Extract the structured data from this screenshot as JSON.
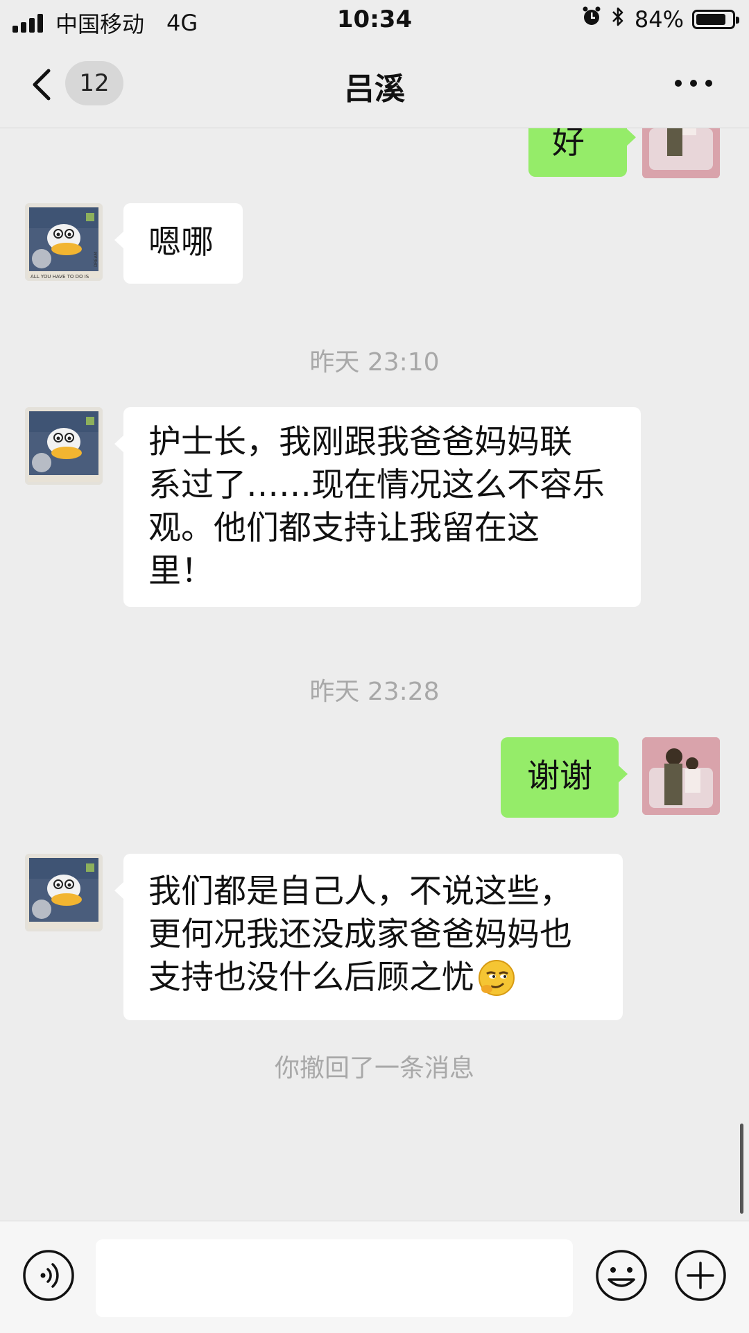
{
  "status_bar": {
    "carrier": "中国移动",
    "network": "4G",
    "time": "10:34",
    "battery_text": "84%",
    "battery_level": 0.84
  },
  "nav": {
    "unread_count": "12",
    "title": "吕溪"
  },
  "messages": {
    "m0_text": "好",
    "m1_text": "嗯哪",
    "ts1": "昨天 23:10",
    "m2_lines": [
      "护士长，我刚跟我爸爸妈妈联",
      "系过了……现在情况这么不容乐",
      "观。他们都支持让我留在这",
      "里！"
    ],
    "ts2": "昨天 23:28",
    "m3_text": "谢谢",
    "m4_lines": [
      "我们都是自己人，不说这些，",
      "更何况我还没成家爸爸妈妈也",
      "支持也没什么后顾之忧"
    ],
    "m4_emoji": "smirking-face-emoji",
    "recall_notice": "你撤回了一条消息",
    "duck_avatar_caption": "ALL YOU HAVE TO DO IS",
    "duck_avatar_side_caption": "DREAM"
  },
  "input_bar": {
    "voice_icon": "voice-icon",
    "emoji_icon": "emoji-icon",
    "plus_icon": "plus-icon",
    "message_value": ""
  },
  "colors": {
    "background": "#ededed",
    "bubble_self": "#95ec69",
    "bubble_other": "#ffffff",
    "timestamp": "#a8a8a8"
  }
}
